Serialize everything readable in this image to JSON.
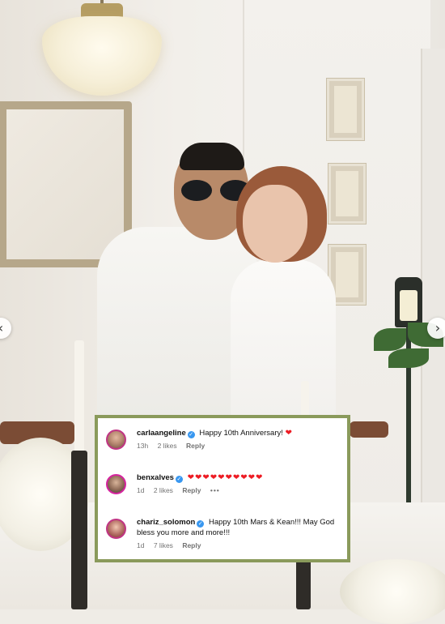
{
  "carousel": {
    "prev_glyph": "‹",
    "next_glyph": "›"
  },
  "comments": [
    {
      "username": "carlaangeline",
      "verified": true,
      "text": "Happy 10th Anniversary!",
      "emoji": "❤",
      "time": "13h",
      "likes": "2 likes",
      "reply_label": "Reply"
    },
    {
      "username": "benxalves",
      "verified": true,
      "text": "",
      "emoji": "❤❤❤❤❤❤❤❤❤❤",
      "time": "1d",
      "likes": "2 likes",
      "reply_label": "Reply",
      "more_label": "•••"
    },
    {
      "username": "chariz_solomon",
      "verified": true,
      "text": "Happy 10th Mars & Kean!!! May God bless you more and more!!!",
      "time": "1d",
      "likes": "7 likes",
      "reply_label": "Reply"
    }
  ],
  "colors": {
    "highlight_border": "#8a9a5b",
    "verified_badge": "#3897f0",
    "heart": "#ed1c24",
    "meta_text": "#737373"
  },
  "icons": [
    "chevron-left-icon",
    "chevron-right-icon",
    "verified-badge-icon",
    "heart-icon",
    "more-icon"
  ]
}
